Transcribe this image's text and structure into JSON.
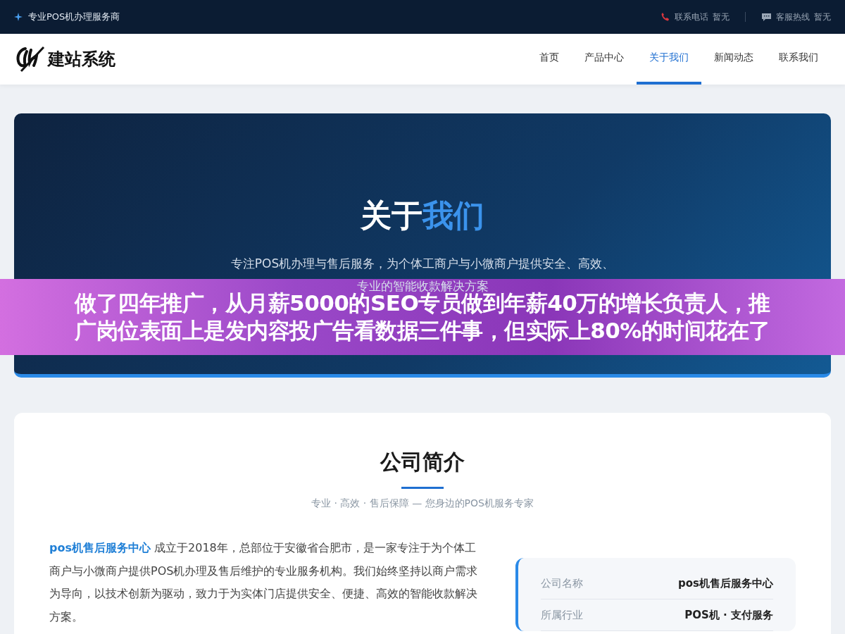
{
  "topbar": {
    "tagline": "专业POS机办理服务商",
    "contacts": [
      {
        "kind": "phone",
        "label": "联系电话",
        "value": "暂无"
      },
      {
        "kind": "chat",
        "label": "客服热线",
        "value": "暂无"
      }
    ]
  },
  "header": {
    "logo_text": "建站系统",
    "nav": [
      {
        "label": "首页",
        "selected": false
      },
      {
        "label": "产品中心",
        "selected": false
      },
      {
        "label": "关于我们",
        "selected": true
      },
      {
        "label": "新闻动态",
        "selected": false
      },
      {
        "label": "联系我们",
        "selected": false
      }
    ]
  },
  "hero": {
    "title_plain": "关于",
    "title_accent": "我们",
    "subtitle_lines": [
      "专注POS机办理与售后服务，为个体工商户与小微商户提供安全、高效、",
      "专业的智能收款解决方案"
    ]
  },
  "overlay_banner": {
    "lines": [
      "做了四年推广，从月薪5000的SEO专员做到年薪40万的增长负责人，推",
      "广岗位表面上是发内容投广告看数据三件事，但实际上80%的时间花在了"
    ]
  },
  "intro": {
    "title": "公司简介",
    "tagline": "专业 · 高效 · 售后保障 — 您身边的POS机服务专家",
    "paragraph": "**pos机售后服务中心** 成立于2018年，总部位于安徽省合肥市，是一家专注于为个体工商户与小微商户提供POS机办理及售后维护的专业服务机构。我们始终坚持以商户需求为导向，以技术创新为驱动，致力于为实体门店提供安全、便捷、高效的智能收款解决方案。",
    "facts": [
      {
        "label": "公司名称",
        "value": "pos机售后服务中心"
      },
      {
        "label": "所属行业",
        "value": "POS机 · 支付服务"
      }
    ]
  }
}
